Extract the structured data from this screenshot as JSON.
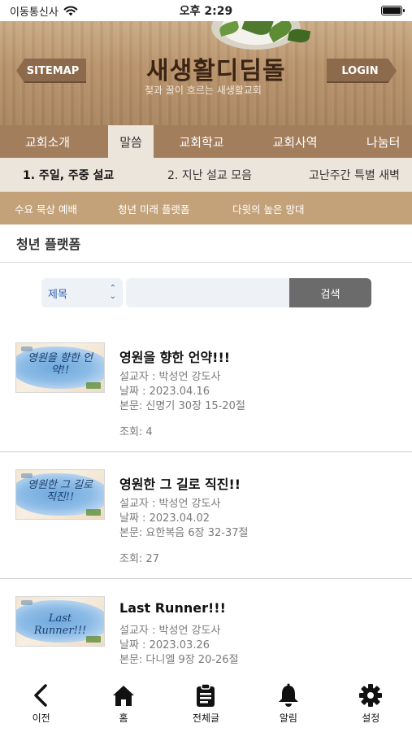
{
  "status_bar": {
    "carrier": "이동통신사",
    "time": "오후 2:29",
    "wifi_icon": "wifi-icon",
    "battery_icon": "battery-icon"
  },
  "header": {
    "sitemap_label": "SITEMAP",
    "login_label": "LOGIN",
    "logo_title": "새생활디딤돌",
    "logo_subtitle": "젖과 꿀이 흐르는 새생활교회"
  },
  "main_menu": [
    {
      "label": "교회소개",
      "active": false
    },
    {
      "label": "말씀",
      "active": true
    },
    {
      "label": "교회학교",
      "active": false
    },
    {
      "label": "교회사역",
      "active": false
    },
    {
      "label": "나눔터",
      "active": false
    }
  ],
  "sub_menu": [
    {
      "label": "1. 주일, 주중 설교",
      "active": true
    },
    {
      "label": "2. 지난 설교 모음",
      "active": false
    },
    {
      "label": "고난주간 특별 새벽",
      "active": false
    }
  ],
  "third_menu": [
    {
      "label": "수요 묵상 예배"
    },
    {
      "label": "청년 미래 플랫폼"
    },
    {
      "label": "다윗의 높은 망대"
    }
  ],
  "page_title": "청년 플랫폼",
  "search": {
    "select_value": "제목",
    "input_value": "",
    "input_placeholder": "",
    "button_label": "검색"
  },
  "posts": [
    {
      "thumb_text": "영원을 향한 언약!!",
      "title": "영원을 향한 언약!!!",
      "preacher": "설교자 : 박성언 강도사",
      "date": "날짜 : 2023.04.16",
      "scripture": "본문: 신명기 30장 15-20절",
      "views": "조회: 4"
    },
    {
      "thumb_text": "영원한 그 길로 직진!!",
      "title": "영원한 그 길로 직진!!",
      "preacher": "설교자 : 박성언 강도사",
      "date": "날짜 : 2023.04.02",
      "scripture": "본문: 요한복음 6장 32-37절",
      "views": "조회: 27"
    },
    {
      "thumb_text": "Last Runner!!!",
      "title": "Last Runner!!!",
      "preacher": "설교자 : 박성언 강도사",
      "date": "날짜 : 2023.03.26",
      "scripture": "본문: 다니엘 9장 20-26절",
      "views": ""
    }
  ],
  "tab_bar": [
    {
      "label": "이전",
      "icon": "chevron-left-icon"
    },
    {
      "label": "홈",
      "icon": "home-icon"
    },
    {
      "label": "전체글",
      "icon": "clipboard-icon"
    },
    {
      "label": "알림",
      "icon": "bell-icon"
    },
    {
      "label": "설정",
      "icon": "gear-icon"
    }
  ]
}
